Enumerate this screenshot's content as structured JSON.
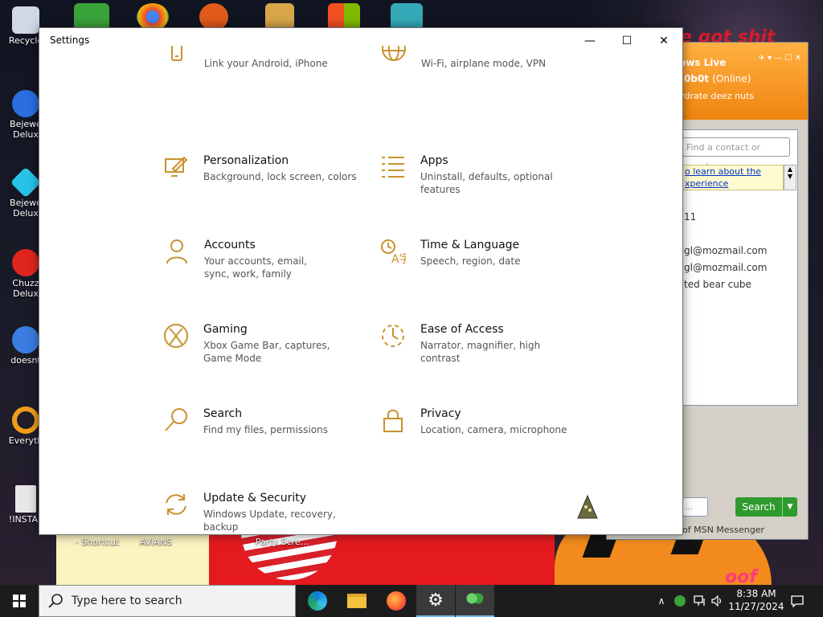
{
  "desktop": {
    "icons": [
      {
        "label": "Recycle",
        "color": "#cfd8e3"
      },
      {
        "label": "Bejewe Delux",
        "color": "#2a6ee0"
      },
      {
        "label": "Bejewe Delux",
        "color": "#27c4e8"
      },
      {
        "label": "Chuzz Delux",
        "color": "#e0261f"
      },
      {
        "label": "doesnt",
        "color": "#3b7de0"
      },
      {
        "label": "Everyth",
        "color": "#f29d1a"
      },
      {
        "label": "!INSTAL",
        "color": "#e8e8e8"
      }
    ],
    "bottom_labels": {
      "shortcut": "- Shortcut",
      "avians": "AVIANS",
      "party": "Party Scre..."
    },
    "pumpkin_text": "oof",
    "top_red_text": "e got shit"
  },
  "settings": {
    "title": "Settings",
    "controls": {
      "minimize": "—",
      "maximize": "☐",
      "close": "✕"
    },
    "tiles": [
      {
        "id": "phone",
        "name": "",
        "desc": "Link your Android, iPhone"
      },
      {
        "id": "network",
        "name": "",
        "desc": "Wi-Fi, airplane mode, VPN"
      },
      {
        "id": "personalization",
        "name": "Personalization",
        "desc": "Background, lock screen, colors"
      },
      {
        "id": "apps",
        "name": "Apps",
        "desc": "Uninstall, defaults, optional features"
      },
      {
        "id": "accounts",
        "name": "Accounts",
        "desc": "Your accounts, email, sync, work, family"
      },
      {
        "id": "time",
        "name": "Time & Language",
        "desc": "Speech, region, date"
      },
      {
        "id": "gaming",
        "name": "Gaming",
        "desc": "Xbox Game Bar, captures, Game Mode"
      },
      {
        "id": "ease",
        "name": "Ease of Access",
        "desc": "Narrator, magnifier, high contrast"
      },
      {
        "id": "search",
        "name": "Search",
        "desc": "Find my files, permissions"
      },
      {
        "id": "privacy",
        "name": "Privacy",
        "desc": "Location, camera, microphone"
      },
      {
        "id": "update",
        "name": "Update & Security",
        "desc": "Windows Update, recovery, backup"
      }
    ],
    "accent": "#c9922e"
  },
  "messenger": {
    "header_title": "ows Live",
    "user_name": "0b0t",
    "status": "(Online)",
    "personal_message": "ydrate deez nuts",
    "find_placeholder": "Find a contact or numbe",
    "note_line1": "o learn about the",
    "note_line2": "xperience",
    "contacts": [
      "11",
      "gl@mozmail.com",
      "gl@mozmail.com",
      "ted bear cube"
    ],
    "search_input": "...",
    "search_button": "Search",
    "footer": "of MSN Messenger",
    "accent": "#f08410"
  },
  "taskbar": {
    "search_placeholder": "Type here to search",
    "time": "8:38 AM",
    "date": "11/27/2024"
  }
}
